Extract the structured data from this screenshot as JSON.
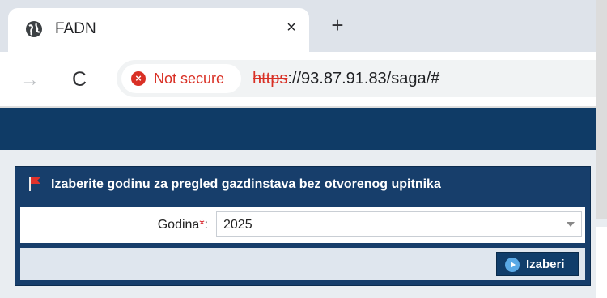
{
  "browser": {
    "tab": {
      "title": "FADN",
      "close": "×"
    },
    "new_tab": "+",
    "nav": {
      "forward": "→",
      "reload": "C"
    },
    "security": {
      "icon": "×",
      "label": "Not secure"
    },
    "url": {
      "protocol": "https",
      "rest": "://93.87.91.83/saga/#"
    }
  },
  "panel": {
    "title": "Izaberite godinu za pregled gazdinstava bez otvorenog upitnika",
    "field": {
      "label": "Godina",
      "required_mark": "*",
      "colon": ":",
      "value": "2025"
    },
    "button_label": "Izaberi"
  },
  "colors": {
    "nav_dark": "#0f3b66",
    "panel": "#173e6b",
    "button": "#103d6a",
    "danger": "#d93025"
  }
}
